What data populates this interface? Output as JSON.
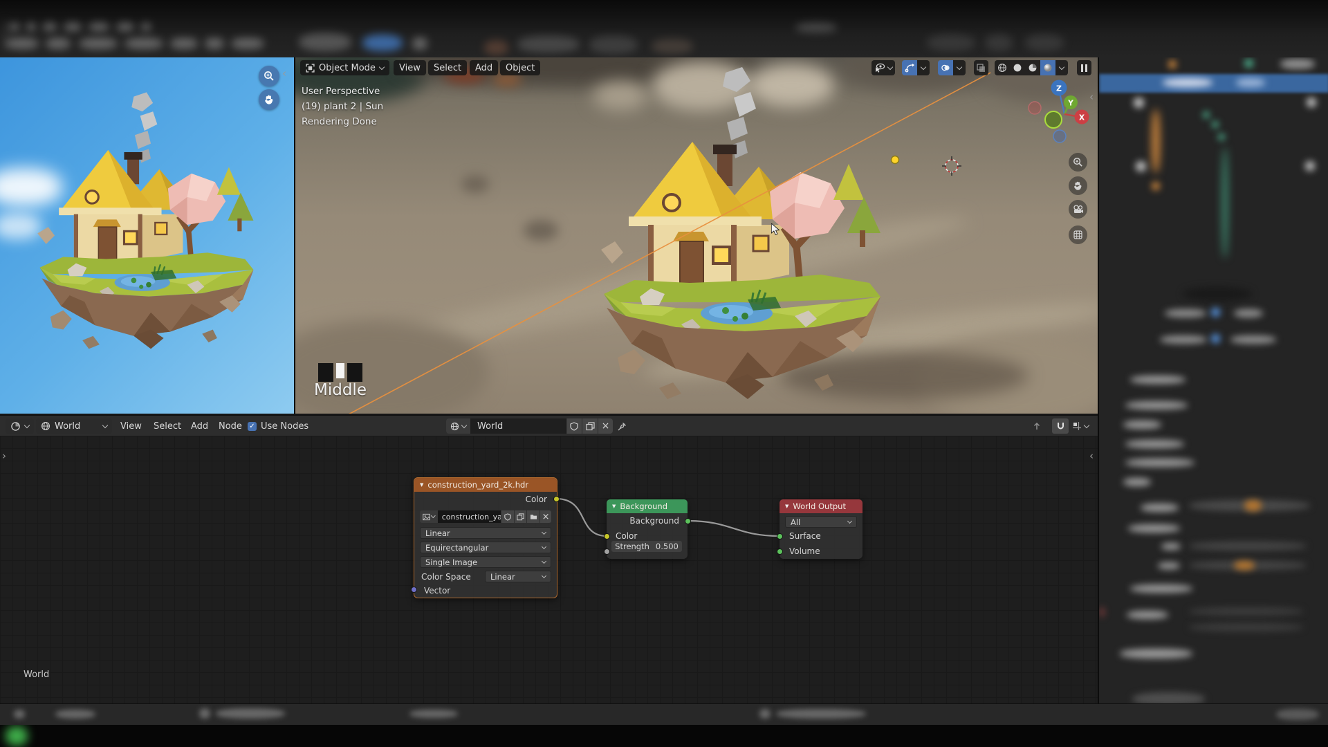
{
  "colors": {
    "accent_blue": "#4772b3",
    "env_node_header": "#9a5526",
    "background_node_header": "#3c965a",
    "world_output_node_header": "#96373c",
    "socket_yellow": "#c7c72a",
    "socket_green": "#5cc25c",
    "socket_gray": "#a1a1a1",
    "socket_purple": "#7070c8",
    "noodle": "#9a9a9a",
    "sun_ray": "#e8913f"
  },
  "viewport": {
    "mode_label": "Object Mode",
    "menus": [
      "View",
      "Select",
      "Add",
      "Object"
    ],
    "info_lines": [
      "User Perspective",
      "(19) plant 2 | Sun",
      "Rendering Done"
    ],
    "mouse_hint": "Middle",
    "gizmo": {
      "z": "Z",
      "y": "Y",
      "x": "X"
    }
  },
  "node_editor_header": {
    "tree_type_value": "World",
    "menus": [
      "View",
      "Select",
      "Add",
      "Node"
    ],
    "use_nodes_label": "Use Nodes",
    "datablock_value": "World"
  },
  "node_editor": {
    "breadcrumb": "World",
    "nodes": {
      "env_texture": {
        "title": "construction_yard_2k.hdr",
        "output": "Color",
        "image_name": "construction_ya...",
        "interpolation": "Linear",
        "projection": "Equirectangular",
        "source": "Single Image",
        "color_space_label": "Color Space",
        "color_space_value": "Linear",
        "input": "Vector"
      },
      "background": {
        "title": "Background",
        "output": "Background",
        "color_input": "Color",
        "strength_label": "Strength",
        "strength_value": "0.500"
      },
      "world_output": {
        "title": "World Output",
        "target": "All",
        "surface_input": "Surface",
        "volume_input": "Volume"
      }
    }
  }
}
